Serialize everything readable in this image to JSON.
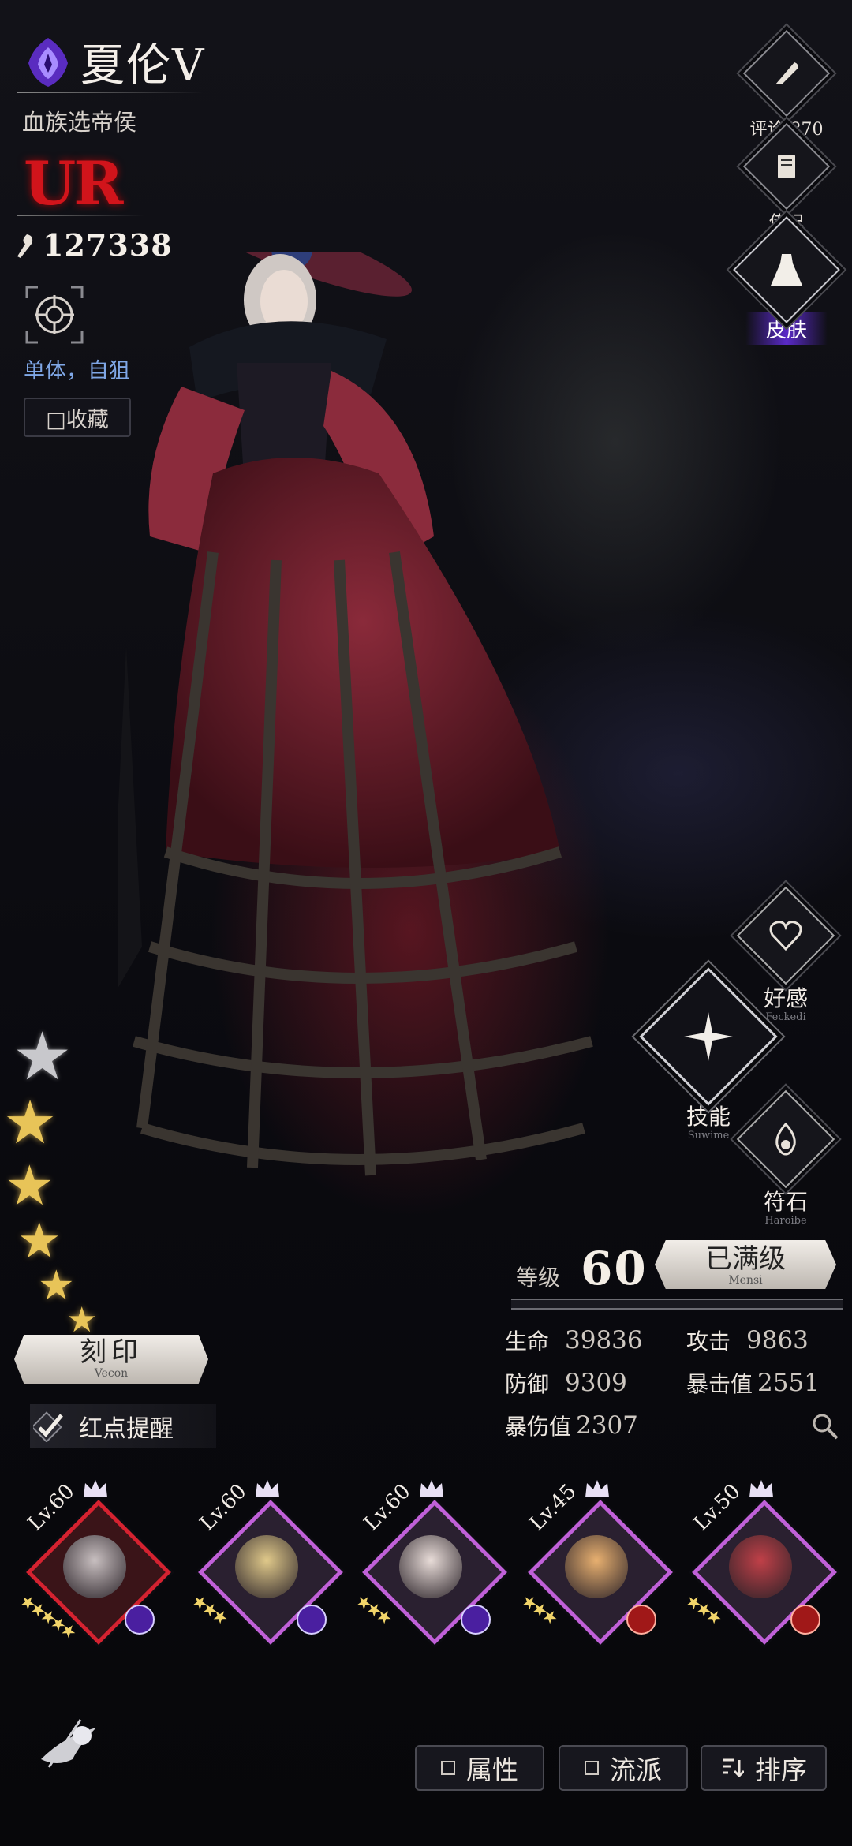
{
  "character": {
    "name": "夏伦V",
    "title": "血族选帝侯",
    "rarity": "UR",
    "power": "127338",
    "target_type": "单体，自狙",
    "favorite_label": "□收藏",
    "star_count": 6
  },
  "right_menu": {
    "comments": "评论 870",
    "biography": "传记",
    "skin": "皮肤"
  },
  "side_actions": {
    "affinity": {
      "label": "好感",
      "sub": "Feckedi"
    },
    "skills": {
      "label": "技能",
      "sub": "Suwime"
    },
    "runes": {
      "label": "符石",
      "sub": "Haroibe"
    }
  },
  "level": {
    "label": "等级",
    "value": "60",
    "max_label": "已满级",
    "max_sub": "Mensi"
  },
  "stats": [
    {
      "label": "生命",
      "value": "39836"
    },
    {
      "label": "攻击",
      "value": "9863"
    },
    {
      "label": "防御",
      "value": "9309"
    },
    {
      "label": "暴击值",
      "value": "2551"
    },
    {
      "label": "暴伤值",
      "value": "2307"
    }
  ],
  "engrave": {
    "label": "刻印",
    "sub": "Vecon"
  },
  "red_dot": {
    "label": "红点提醒",
    "checked": true
  },
  "roster": [
    {
      "level": "Lv.60",
      "stars": "★★★★★",
      "selected": true,
      "badge": "purple"
    },
    {
      "level": "Lv.60",
      "stars": "★★★",
      "selected": false,
      "badge": "purple"
    },
    {
      "level": "Lv.60",
      "stars": "★★★",
      "selected": false,
      "badge": "purple"
    },
    {
      "level": "Lv.45",
      "stars": "★★★",
      "selected": false,
      "badge": "red"
    },
    {
      "level": "Lv.50",
      "stars": "★★★",
      "selected": false,
      "badge": "red"
    }
  ],
  "bottom": {
    "attribute": "属性",
    "school": "流派",
    "sort": "排序"
  },
  "colors": {
    "rarity": "#d1141b",
    "tag": "#7fa7e6",
    "skin_highlight": "#5a2ac8"
  }
}
